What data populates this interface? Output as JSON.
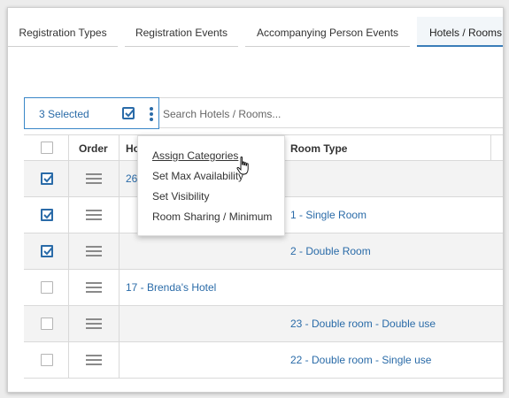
{
  "tabs": [
    {
      "label": "Registration Types"
    },
    {
      "label": "Registration Events"
    },
    {
      "label": "Accompanying Person Events"
    },
    {
      "label": "Hotels / Rooms"
    }
  ],
  "toolbar": {
    "selected_label": "3 Selected",
    "search_placeholder": "Search Hotels / Rooms..."
  },
  "table": {
    "headers": {
      "order": "Order",
      "hotel": "Ho",
      "room_type": "Room Type"
    },
    "rows": [
      {
        "checked": true,
        "hotel": "26",
        "room_type": "",
        "edge": ""
      },
      {
        "checked": true,
        "hotel": "",
        "room_type": "1 - Single Room",
        "edge": "2"
      },
      {
        "checked": true,
        "hotel": "",
        "room_type": "2 - Double Room",
        "edge": "2"
      },
      {
        "checked": false,
        "hotel": "17 - Brenda's Hotel",
        "room_type": "",
        "edge": ""
      },
      {
        "checked": false,
        "hotel": "",
        "room_type": "23 - Double room - Double use",
        "edge": "2"
      },
      {
        "checked": false,
        "hotel": "",
        "room_type": "22 - Double room - Single use",
        "edge": "2"
      }
    ]
  },
  "menu": {
    "items": [
      {
        "label": "Assign Categories"
      },
      {
        "label": "Set Max Availability"
      },
      {
        "label": "Set Visibility"
      },
      {
        "label": "Room Sharing / Minimum"
      }
    ]
  },
  "colors": {
    "accent": "#2a6ba8",
    "border": "#d9d9d9",
    "row_shade": "#f3f3f3"
  }
}
